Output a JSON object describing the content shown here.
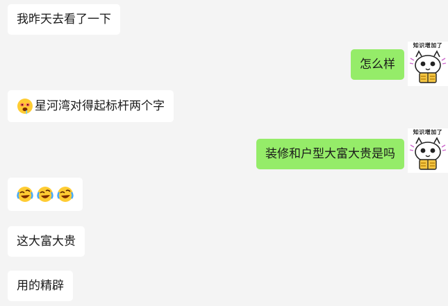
{
  "messages": [
    {
      "side": "in",
      "text": "我昨天去看了一下"
    },
    {
      "side": "out",
      "text": "怎么样",
      "avatar_caption": "知识增加了"
    },
    {
      "side": "in",
      "emoji": "drooling-face-emoji",
      "text": "星河湾对得起标杆两个字"
    },
    {
      "side": "out",
      "text": "装修和户型大富大贵是吗",
      "avatar_caption": "知识增加了"
    },
    {
      "side": "in",
      "emojis": [
        "rolling-laughing-emoji",
        "rolling-laughing-emoji",
        "rolling-laughing-emoji"
      ]
    },
    {
      "side": "in",
      "text": "这大富大贵"
    },
    {
      "side": "in",
      "text": "用的精辟"
    }
  ],
  "colors": {
    "background": "#f4f4f4",
    "incoming_bubble": "#ffffff",
    "outgoing_bubble": "#95ec69",
    "text": "#1a1a1a"
  }
}
